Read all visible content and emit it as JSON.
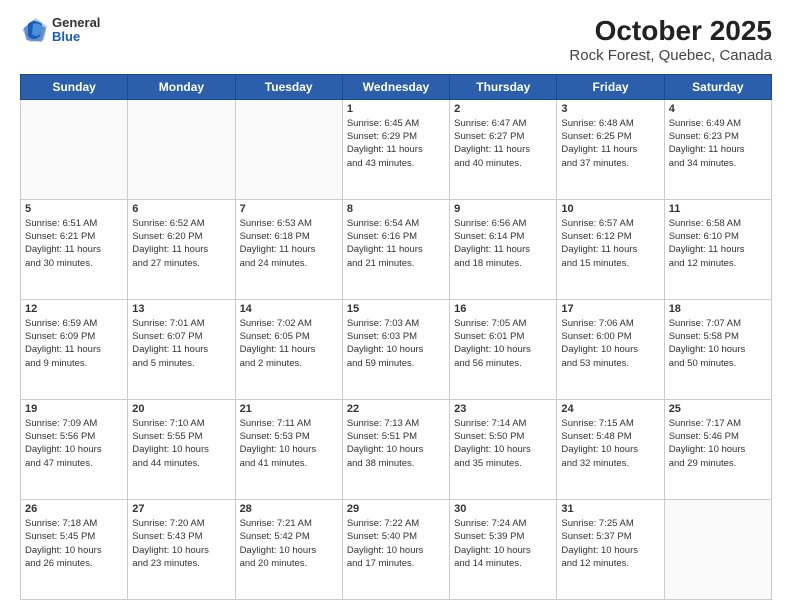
{
  "header": {
    "logo_general": "General",
    "logo_blue": "Blue",
    "title": "October 2025",
    "subtitle": "Rock Forest, Quebec, Canada"
  },
  "days_of_week": [
    "Sunday",
    "Monday",
    "Tuesday",
    "Wednesday",
    "Thursday",
    "Friday",
    "Saturday"
  ],
  "weeks": [
    [
      {
        "day": "",
        "content": ""
      },
      {
        "day": "",
        "content": ""
      },
      {
        "day": "",
        "content": ""
      },
      {
        "day": "1",
        "content": "Sunrise: 6:45 AM\nSunset: 6:29 PM\nDaylight: 11 hours\nand 43 minutes."
      },
      {
        "day": "2",
        "content": "Sunrise: 6:47 AM\nSunset: 6:27 PM\nDaylight: 11 hours\nand 40 minutes."
      },
      {
        "day": "3",
        "content": "Sunrise: 6:48 AM\nSunset: 6:25 PM\nDaylight: 11 hours\nand 37 minutes."
      },
      {
        "day": "4",
        "content": "Sunrise: 6:49 AM\nSunset: 6:23 PM\nDaylight: 11 hours\nand 34 minutes."
      }
    ],
    [
      {
        "day": "5",
        "content": "Sunrise: 6:51 AM\nSunset: 6:21 PM\nDaylight: 11 hours\nand 30 minutes."
      },
      {
        "day": "6",
        "content": "Sunrise: 6:52 AM\nSunset: 6:20 PM\nDaylight: 11 hours\nand 27 minutes."
      },
      {
        "day": "7",
        "content": "Sunrise: 6:53 AM\nSunset: 6:18 PM\nDaylight: 11 hours\nand 24 minutes."
      },
      {
        "day": "8",
        "content": "Sunrise: 6:54 AM\nSunset: 6:16 PM\nDaylight: 11 hours\nand 21 minutes."
      },
      {
        "day": "9",
        "content": "Sunrise: 6:56 AM\nSunset: 6:14 PM\nDaylight: 11 hours\nand 18 minutes."
      },
      {
        "day": "10",
        "content": "Sunrise: 6:57 AM\nSunset: 6:12 PM\nDaylight: 11 hours\nand 15 minutes."
      },
      {
        "day": "11",
        "content": "Sunrise: 6:58 AM\nSunset: 6:10 PM\nDaylight: 11 hours\nand 12 minutes."
      }
    ],
    [
      {
        "day": "12",
        "content": "Sunrise: 6:59 AM\nSunset: 6:09 PM\nDaylight: 11 hours\nand 9 minutes."
      },
      {
        "day": "13",
        "content": "Sunrise: 7:01 AM\nSunset: 6:07 PM\nDaylight: 11 hours\nand 5 minutes."
      },
      {
        "day": "14",
        "content": "Sunrise: 7:02 AM\nSunset: 6:05 PM\nDaylight: 11 hours\nand 2 minutes."
      },
      {
        "day": "15",
        "content": "Sunrise: 7:03 AM\nSunset: 6:03 PM\nDaylight: 10 hours\nand 59 minutes."
      },
      {
        "day": "16",
        "content": "Sunrise: 7:05 AM\nSunset: 6:01 PM\nDaylight: 10 hours\nand 56 minutes."
      },
      {
        "day": "17",
        "content": "Sunrise: 7:06 AM\nSunset: 6:00 PM\nDaylight: 10 hours\nand 53 minutes."
      },
      {
        "day": "18",
        "content": "Sunrise: 7:07 AM\nSunset: 5:58 PM\nDaylight: 10 hours\nand 50 minutes."
      }
    ],
    [
      {
        "day": "19",
        "content": "Sunrise: 7:09 AM\nSunset: 5:56 PM\nDaylight: 10 hours\nand 47 minutes."
      },
      {
        "day": "20",
        "content": "Sunrise: 7:10 AM\nSunset: 5:55 PM\nDaylight: 10 hours\nand 44 minutes."
      },
      {
        "day": "21",
        "content": "Sunrise: 7:11 AM\nSunset: 5:53 PM\nDaylight: 10 hours\nand 41 minutes."
      },
      {
        "day": "22",
        "content": "Sunrise: 7:13 AM\nSunset: 5:51 PM\nDaylight: 10 hours\nand 38 minutes."
      },
      {
        "day": "23",
        "content": "Sunrise: 7:14 AM\nSunset: 5:50 PM\nDaylight: 10 hours\nand 35 minutes."
      },
      {
        "day": "24",
        "content": "Sunrise: 7:15 AM\nSunset: 5:48 PM\nDaylight: 10 hours\nand 32 minutes."
      },
      {
        "day": "25",
        "content": "Sunrise: 7:17 AM\nSunset: 5:46 PM\nDaylight: 10 hours\nand 29 minutes."
      }
    ],
    [
      {
        "day": "26",
        "content": "Sunrise: 7:18 AM\nSunset: 5:45 PM\nDaylight: 10 hours\nand 26 minutes."
      },
      {
        "day": "27",
        "content": "Sunrise: 7:20 AM\nSunset: 5:43 PM\nDaylight: 10 hours\nand 23 minutes."
      },
      {
        "day": "28",
        "content": "Sunrise: 7:21 AM\nSunset: 5:42 PM\nDaylight: 10 hours\nand 20 minutes."
      },
      {
        "day": "29",
        "content": "Sunrise: 7:22 AM\nSunset: 5:40 PM\nDaylight: 10 hours\nand 17 minutes."
      },
      {
        "day": "30",
        "content": "Sunrise: 7:24 AM\nSunset: 5:39 PM\nDaylight: 10 hours\nand 14 minutes."
      },
      {
        "day": "31",
        "content": "Sunrise: 7:25 AM\nSunset: 5:37 PM\nDaylight: 10 hours\nand 12 minutes."
      },
      {
        "day": "",
        "content": ""
      }
    ]
  ]
}
